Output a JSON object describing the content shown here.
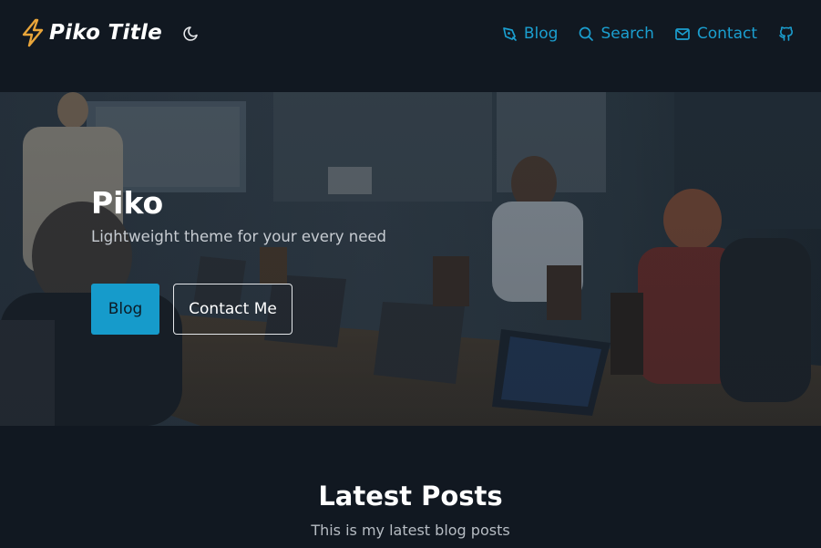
{
  "header": {
    "site_title": "Piko Title",
    "icons": {
      "logo": "bolt-icon",
      "theme": "moon-icon"
    },
    "nav": [
      {
        "label": "Blog",
        "icon": "pen-icon"
      },
      {
        "label": "Search",
        "icon": "search-icon"
      },
      {
        "label": "Contact",
        "icon": "mail-icon"
      },
      {
        "label": "",
        "icon": "github-icon"
      }
    ]
  },
  "hero": {
    "title": "Piko",
    "subtitle": "Lightweight theme for your every need",
    "primary_button": "Blog",
    "secondary_button": "Contact Me",
    "background_image": "meeting-room-photo"
  },
  "latest": {
    "title": "Latest Posts",
    "subtitle": "This is my latest blog posts"
  },
  "colors": {
    "background": "#111821",
    "accent": "#169bcb",
    "logo": "#e9a53a",
    "text": "#ffffff"
  }
}
